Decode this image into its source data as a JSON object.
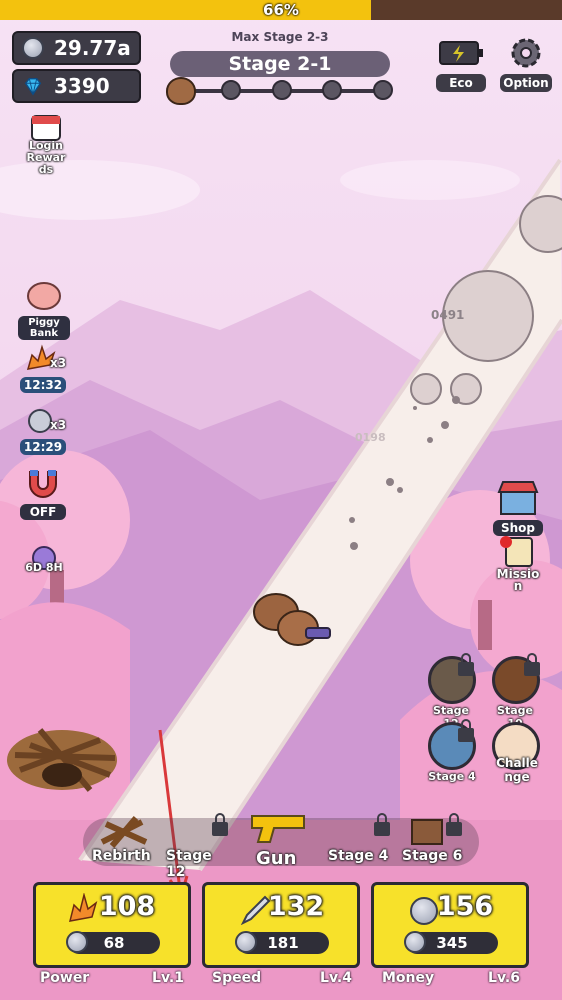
{
  "progress": {
    "percent": 0.66,
    "label": "66%"
  },
  "currency": {
    "silver": "29.77a",
    "gems": "3390"
  },
  "stage": {
    "max_label": "Max Stage 2-3",
    "current": "Stage 2-1",
    "stage_nodes": 5
  },
  "top_buttons": {
    "eco": "Eco",
    "option": "Option"
  },
  "left_menu": {
    "login_rewards": "Login\nRewar\nds",
    "piggy_bank": "Piggy\nBank",
    "power_boost": {
      "mult": "x3",
      "timer": "12:32"
    },
    "coin_boost": {
      "mult": "x3",
      "timer": "12:29"
    },
    "magnet": {
      "state": "OFF"
    },
    "alarm": {
      "timer": "6D 8H"
    }
  },
  "enemies": {
    "big_rock_hp": "0491",
    "small_rock_hp": "0198"
  },
  "right_menu": {
    "shop": "Shop",
    "mission": "Missio\nn",
    "stage12": "Stage 12",
    "stage10": "Stage 10",
    "stage4": "Stage 4",
    "challenge": "Challe\nnge"
  },
  "slots": {
    "rebirth": "Rebirth",
    "stage12": "Stage 12",
    "gun": "Gun",
    "stage4": "Stage 4",
    "stage6": "Stage 6"
  },
  "cards": [
    {
      "value": "108",
      "cost": "68",
      "name": "Power",
      "level": "Lv.1",
      "icon": "power-icon"
    },
    {
      "value": "132",
      "cost": "181",
      "name": "Speed",
      "level": "Lv.4",
      "icon": "sword-icon"
    },
    {
      "value": "156",
      "cost": "345",
      "name": "Money",
      "level": "Lv.6",
      "icon": "coin-icon"
    }
  ],
  "colors": {
    "accent_yellow": "#f7e12a",
    "progress_fill": "#f3c20e",
    "panel_dark": "#3d3b46",
    "arrow_red": "#d9383a"
  }
}
